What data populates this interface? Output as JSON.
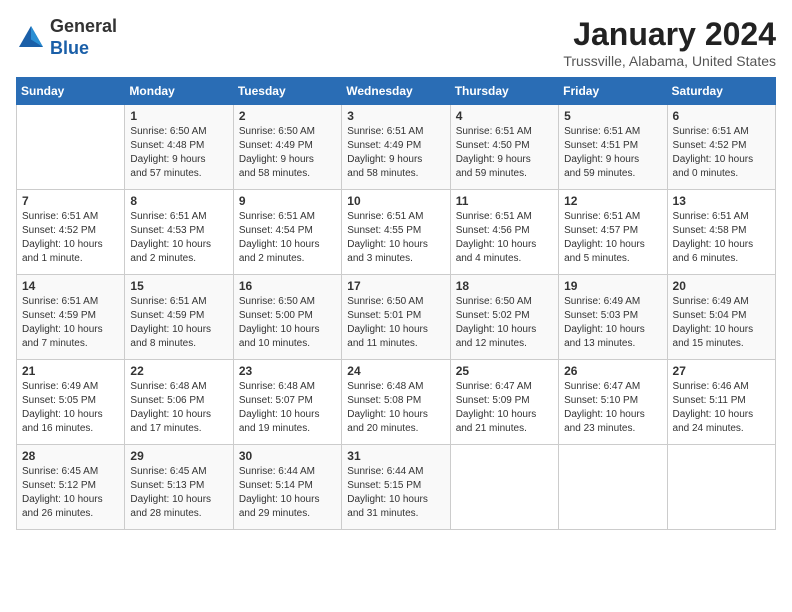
{
  "header": {
    "logo_general": "General",
    "logo_blue": "Blue",
    "title": "January 2024",
    "subtitle": "Trussville, Alabama, United States"
  },
  "weekdays": [
    "Sunday",
    "Monday",
    "Tuesday",
    "Wednesday",
    "Thursday",
    "Friday",
    "Saturday"
  ],
  "weeks": [
    [
      {
        "day": "",
        "info": ""
      },
      {
        "day": "1",
        "info": "Sunrise: 6:50 AM\nSunset: 4:48 PM\nDaylight: 9 hours\nand 57 minutes."
      },
      {
        "day": "2",
        "info": "Sunrise: 6:50 AM\nSunset: 4:49 PM\nDaylight: 9 hours\nand 58 minutes."
      },
      {
        "day": "3",
        "info": "Sunrise: 6:51 AM\nSunset: 4:49 PM\nDaylight: 9 hours\nand 58 minutes."
      },
      {
        "day": "4",
        "info": "Sunrise: 6:51 AM\nSunset: 4:50 PM\nDaylight: 9 hours\nand 59 minutes."
      },
      {
        "day": "5",
        "info": "Sunrise: 6:51 AM\nSunset: 4:51 PM\nDaylight: 9 hours\nand 59 minutes."
      },
      {
        "day": "6",
        "info": "Sunrise: 6:51 AM\nSunset: 4:52 PM\nDaylight: 10 hours\nand 0 minutes."
      }
    ],
    [
      {
        "day": "7",
        "info": "Sunrise: 6:51 AM\nSunset: 4:52 PM\nDaylight: 10 hours\nand 1 minute."
      },
      {
        "day": "8",
        "info": "Sunrise: 6:51 AM\nSunset: 4:53 PM\nDaylight: 10 hours\nand 2 minutes."
      },
      {
        "day": "9",
        "info": "Sunrise: 6:51 AM\nSunset: 4:54 PM\nDaylight: 10 hours\nand 2 minutes."
      },
      {
        "day": "10",
        "info": "Sunrise: 6:51 AM\nSunset: 4:55 PM\nDaylight: 10 hours\nand 3 minutes."
      },
      {
        "day": "11",
        "info": "Sunrise: 6:51 AM\nSunset: 4:56 PM\nDaylight: 10 hours\nand 4 minutes."
      },
      {
        "day": "12",
        "info": "Sunrise: 6:51 AM\nSunset: 4:57 PM\nDaylight: 10 hours\nand 5 minutes."
      },
      {
        "day": "13",
        "info": "Sunrise: 6:51 AM\nSunset: 4:58 PM\nDaylight: 10 hours\nand 6 minutes."
      }
    ],
    [
      {
        "day": "14",
        "info": "Sunrise: 6:51 AM\nSunset: 4:59 PM\nDaylight: 10 hours\nand 7 minutes."
      },
      {
        "day": "15",
        "info": "Sunrise: 6:51 AM\nSunset: 4:59 PM\nDaylight: 10 hours\nand 8 minutes."
      },
      {
        "day": "16",
        "info": "Sunrise: 6:50 AM\nSunset: 5:00 PM\nDaylight: 10 hours\nand 10 minutes."
      },
      {
        "day": "17",
        "info": "Sunrise: 6:50 AM\nSunset: 5:01 PM\nDaylight: 10 hours\nand 11 minutes."
      },
      {
        "day": "18",
        "info": "Sunrise: 6:50 AM\nSunset: 5:02 PM\nDaylight: 10 hours\nand 12 minutes."
      },
      {
        "day": "19",
        "info": "Sunrise: 6:49 AM\nSunset: 5:03 PM\nDaylight: 10 hours\nand 13 minutes."
      },
      {
        "day": "20",
        "info": "Sunrise: 6:49 AM\nSunset: 5:04 PM\nDaylight: 10 hours\nand 15 minutes."
      }
    ],
    [
      {
        "day": "21",
        "info": "Sunrise: 6:49 AM\nSunset: 5:05 PM\nDaylight: 10 hours\nand 16 minutes."
      },
      {
        "day": "22",
        "info": "Sunrise: 6:48 AM\nSunset: 5:06 PM\nDaylight: 10 hours\nand 17 minutes."
      },
      {
        "day": "23",
        "info": "Sunrise: 6:48 AM\nSunset: 5:07 PM\nDaylight: 10 hours\nand 19 minutes."
      },
      {
        "day": "24",
        "info": "Sunrise: 6:48 AM\nSunset: 5:08 PM\nDaylight: 10 hours\nand 20 minutes."
      },
      {
        "day": "25",
        "info": "Sunrise: 6:47 AM\nSunset: 5:09 PM\nDaylight: 10 hours\nand 21 minutes."
      },
      {
        "day": "26",
        "info": "Sunrise: 6:47 AM\nSunset: 5:10 PM\nDaylight: 10 hours\nand 23 minutes."
      },
      {
        "day": "27",
        "info": "Sunrise: 6:46 AM\nSunset: 5:11 PM\nDaylight: 10 hours\nand 24 minutes."
      }
    ],
    [
      {
        "day": "28",
        "info": "Sunrise: 6:45 AM\nSunset: 5:12 PM\nDaylight: 10 hours\nand 26 minutes."
      },
      {
        "day": "29",
        "info": "Sunrise: 6:45 AM\nSunset: 5:13 PM\nDaylight: 10 hours\nand 28 minutes."
      },
      {
        "day": "30",
        "info": "Sunrise: 6:44 AM\nSunset: 5:14 PM\nDaylight: 10 hours\nand 29 minutes."
      },
      {
        "day": "31",
        "info": "Sunrise: 6:44 AM\nSunset: 5:15 PM\nDaylight: 10 hours\nand 31 minutes."
      },
      {
        "day": "",
        "info": ""
      },
      {
        "day": "",
        "info": ""
      },
      {
        "day": "",
        "info": ""
      }
    ]
  ]
}
